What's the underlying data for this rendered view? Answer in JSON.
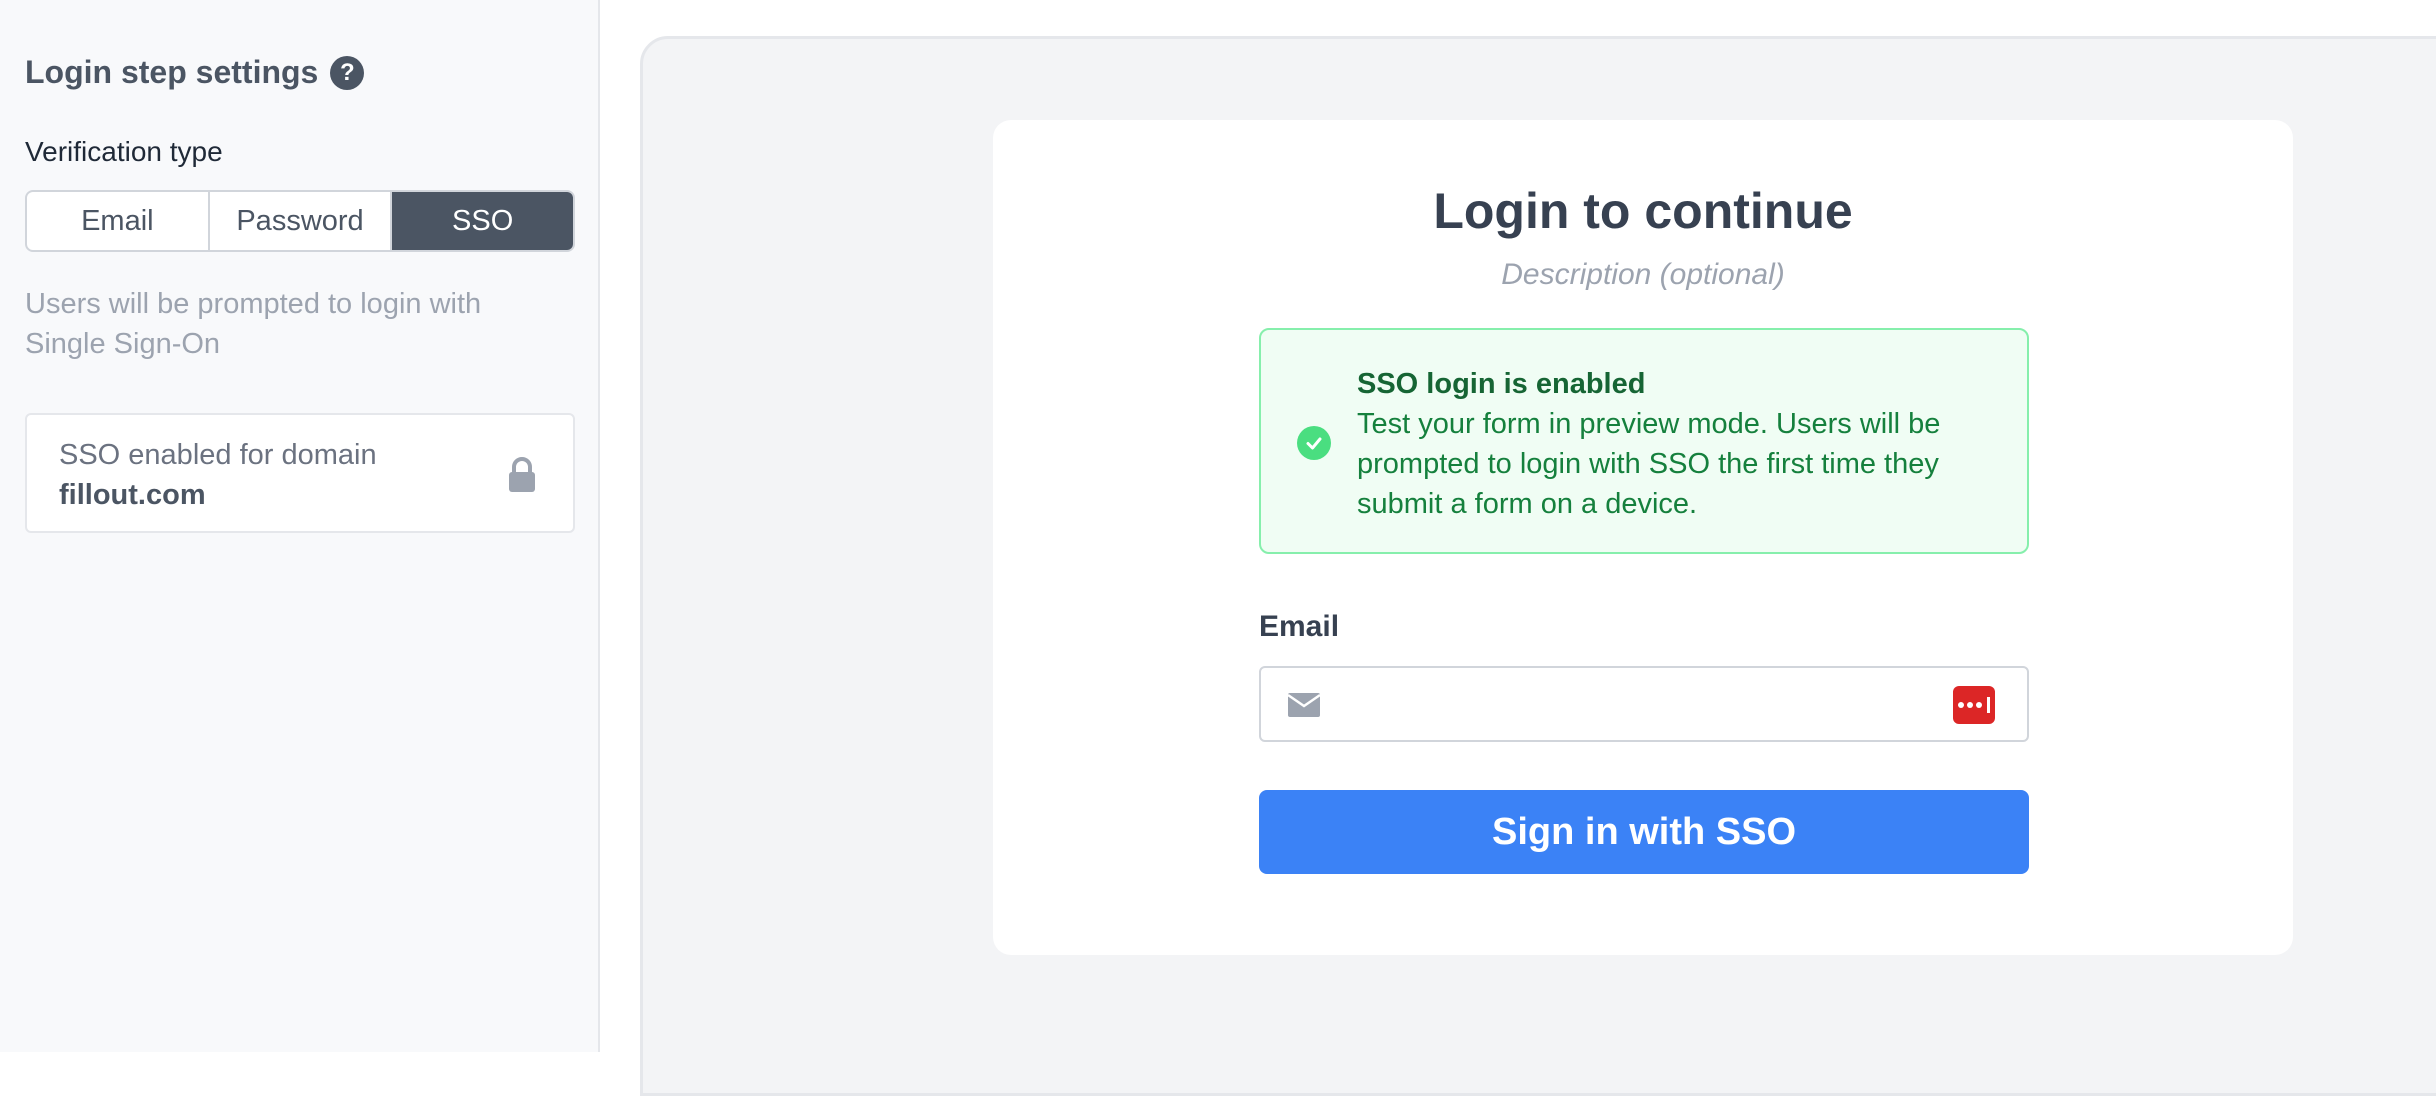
{
  "sidebar": {
    "title": "Login step settings",
    "help_icon": "help-circle-icon",
    "verification_label": "Verification type",
    "segments": [
      {
        "label": "Email",
        "active": false
      },
      {
        "label": "Password",
        "active": false
      },
      {
        "label": "SSO",
        "active": true
      }
    ],
    "helper_text": "Users will be prompted to login with Single Sign-On",
    "sso_box": {
      "label": "SSO enabled for domain",
      "domain": "fillout.com",
      "icon": "lock-icon"
    }
  },
  "preview": {
    "title": "Login to continue",
    "description": "Description (optional)",
    "alert": {
      "icon": "check-circle-icon",
      "title": "SSO login is enabled",
      "body": "Test your form in preview mode. Users will be prompted to login with SSO the first time they submit a form on a device."
    },
    "email": {
      "label": "Email",
      "value": "",
      "placeholder": "",
      "left_icon": "mail-icon",
      "right_icon": "password-manager-icon"
    },
    "button_label": "Sign in with SSO"
  },
  "colors": {
    "accent": "#3b82f6",
    "segment_active": "#4b5563",
    "alert_bg": "#f0fdf4",
    "alert_text": "#15803d",
    "password_manager": "#dc2626"
  }
}
